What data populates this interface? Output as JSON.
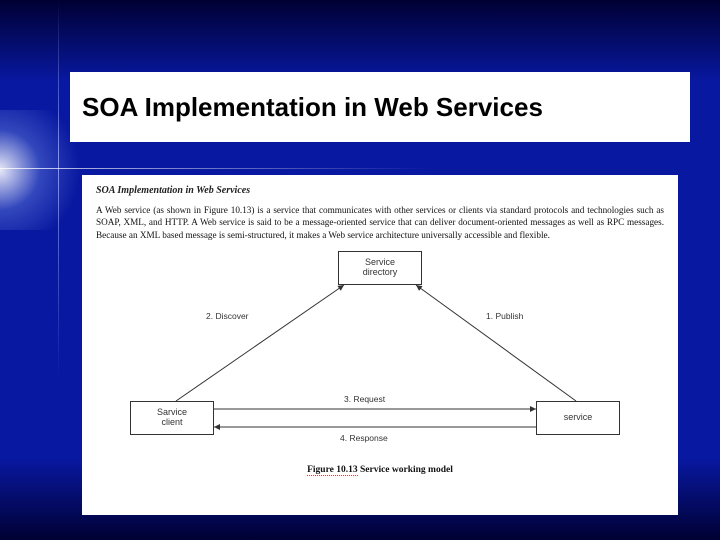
{
  "title": "SOA Implementation in Web Services",
  "subheading": "SOA Implementation in Web Services",
  "body": "A Web service (as shown in Figure 10.13) is a service that communicates with other services or clients via standard protocols and technologies such as SOAP, XML, and HTTP.  A Web service is said to be a message-oriented service that can deliver document-oriented messages as well as RPC messages. Because an XML based message is semi-structured, it makes a Web service architecture universally accessible and flexible.",
  "diagram": {
    "nodes": {
      "directory": "Service\ndirectory",
      "client": "Sarvice\nclient",
      "service": "service"
    },
    "edges": {
      "publish": "1. Publish",
      "discover": "2. Discover",
      "request": "3. Request",
      "response": "4. Response"
    }
  },
  "caption_label": "Figure 10.13",
  "caption_text": " Service working model"
}
